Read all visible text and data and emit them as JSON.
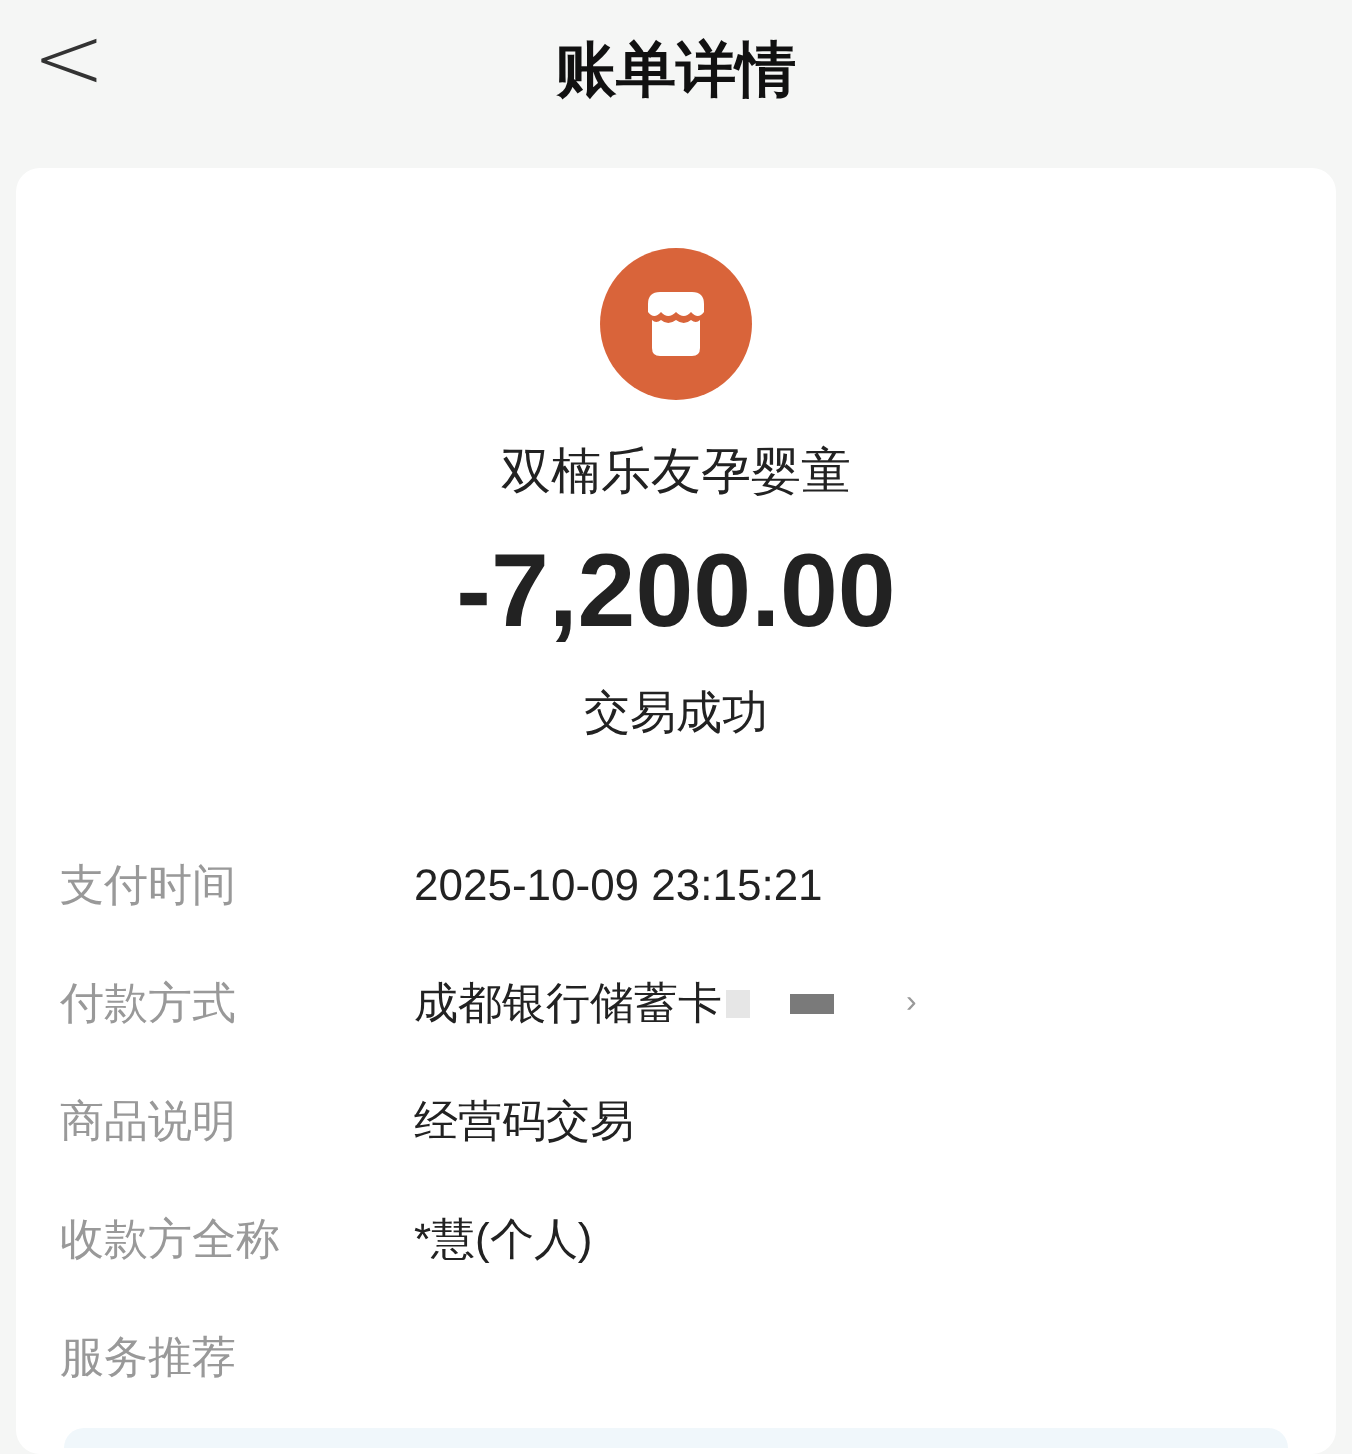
{
  "header": {
    "back": "<",
    "title": "账单详情"
  },
  "merchant": {
    "name": "双楠乐友孕婴童",
    "amount": "-7,200.00",
    "status": "交易成功"
  },
  "details": [
    {
      "kind": "text",
      "label": "支付时间",
      "value": "2025-10-09 23:15:21"
    },
    {
      "kind": "link",
      "label": "付款方式",
      "value": "成都银行储蓄卡",
      "chevron": "›"
    },
    {
      "kind": "text",
      "label": "商品说明",
      "value": "经营码交易"
    },
    {
      "kind": "text",
      "label": "收款方全称",
      "value": "*慧(个人)"
    },
    {
      "kind": "section",
      "label": "服务推荐"
    }
  ]
}
